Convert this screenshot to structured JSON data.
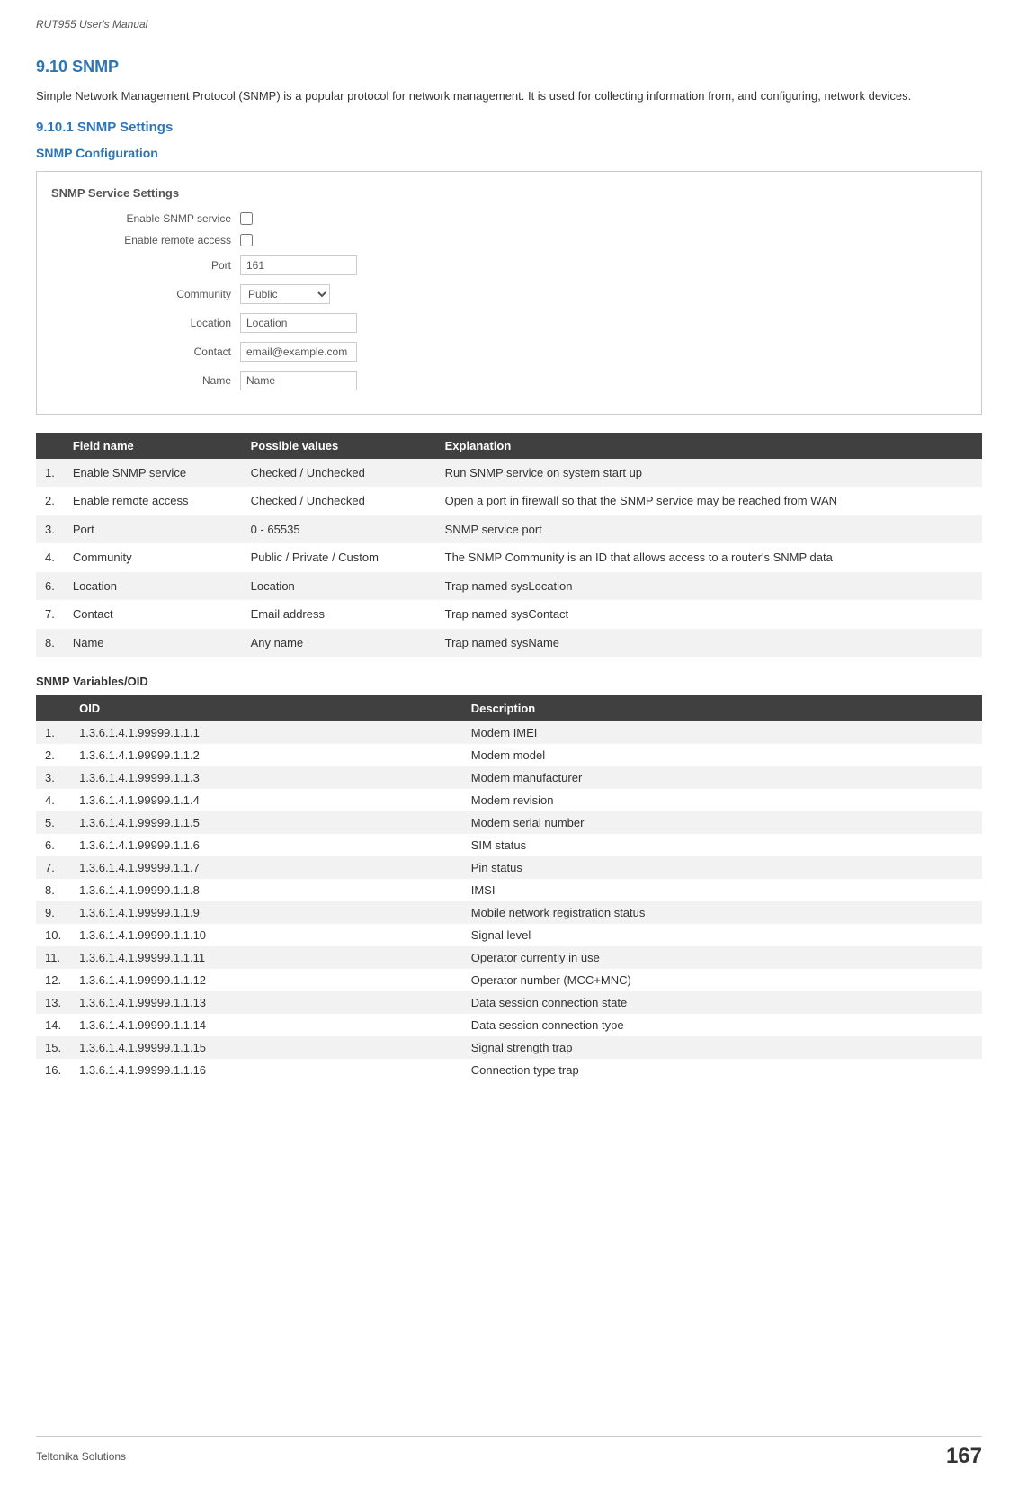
{
  "header": {
    "title": "RUT955 User's Manual"
  },
  "section": {
    "number": "9.10",
    "title": "SNMP",
    "description": "Simple Network Management Protocol (SNMP) is a popular protocol for network management. It is used for collecting information from, and configuring, network devices."
  },
  "subsection": {
    "number": "9.10.1",
    "title": "SNMP Settings"
  },
  "config": {
    "title": "SNMP Configuration",
    "section_label": "SNMP Service Settings",
    "fields": {
      "enable_snmp_label": "Enable SNMP service",
      "enable_remote_label": "Enable remote access",
      "port_label": "Port",
      "port_value": "161",
      "community_label": "Community",
      "community_value": "Public",
      "location_label": "Location",
      "location_value": "Location",
      "contact_label": "Contact",
      "contact_value": "email@example.com",
      "name_label": "Name",
      "name_value": "Name"
    }
  },
  "main_table": {
    "columns": [
      "",
      "Field name",
      "Possible values",
      "Explanation"
    ],
    "rows": [
      {
        "num": "1.",
        "field": "Enable SNMP service",
        "values": "Checked / Unchecked",
        "explanation": "Run SNMP service on system start up"
      },
      {
        "num": "2.",
        "field": "Enable remote access",
        "values": "Checked / Unchecked",
        "explanation": "Open a port in firewall so that the SNMP service may be reached from WAN"
      },
      {
        "num": "3.",
        "field": "Port",
        "values": "0 - 65535",
        "explanation": "SNMP service port"
      },
      {
        "num": "4.",
        "field": "Community",
        "values": "Public / Private / Custom",
        "explanation": "The SNMP Community is an ID that allows access to a router's SNMP data"
      },
      {
        "num": "6.",
        "field": "Location",
        "values": "Location",
        "explanation": "Trap named sysLocation"
      },
      {
        "num": "7.",
        "field": "Contact",
        "values": "Email address",
        "explanation": "Trap named sysContact"
      },
      {
        "num": "8.",
        "field": "Name",
        "values": "Any name",
        "explanation": "Trap named sysName"
      }
    ]
  },
  "variables_section": {
    "title": "SNMP Variables/OID",
    "columns": [
      "",
      "OID",
      "Description"
    ],
    "rows": [
      {
        "num": "1.",
        "oid": "1.3.6.1.4.1.99999.1.1.1",
        "description": "Modem IMEI"
      },
      {
        "num": "2.",
        "oid": "1.3.6.1.4.1.99999.1.1.2",
        "description": "Modem model"
      },
      {
        "num": "3.",
        "oid": "1.3.6.1.4.1.99999.1.1.3",
        "description": "Modem manufacturer"
      },
      {
        "num": "4.",
        "oid": "1.3.6.1.4.1.99999.1.1.4",
        "description": "Modem revision"
      },
      {
        "num": "5.",
        "oid": "1.3.6.1.4.1.99999.1.1.5",
        "description": "Modem serial number"
      },
      {
        "num": "6.",
        "oid": "1.3.6.1.4.1.99999.1.1.6",
        "description": "SIM status"
      },
      {
        "num": "7.",
        "oid": "1.3.6.1.4.1.99999.1.1.7",
        "description": "Pin status"
      },
      {
        "num": "8.",
        "oid": "1.3.6.1.4.1.99999.1.1.8",
        "description": "IMSI"
      },
      {
        "num": "9.",
        "oid": "1.3.6.1.4.1.99999.1.1.9",
        "description": "Mobile network registration status"
      },
      {
        "num": "10.",
        "oid": "1.3.6.1.4.1.99999.1.1.10",
        "description": "Signal level"
      },
      {
        "num": "11.",
        "oid": "1.3.6.1.4.1.99999.1.1.11",
        "description": "Operator currently in use"
      },
      {
        "num": "12.",
        "oid": "1.3.6.1.4.1.99999.1.1.12",
        "description": "Operator number (MCC+MNC)"
      },
      {
        "num": "13.",
        "oid": "1.3.6.1.4.1.99999.1.1.13",
        "description": "Data session connection state"
      },
      {
        "num": "14.",
        "oid": "1.3.6.1.4.1.99999.1.1.14",
        "description": "Data session connection type"
      },
      {
        "num": "15.",
        "oid": "1.3.6.1.4.1.99999.1.1.15",
        "description": "Signal strength trap"
      },
      {
        "num": "16.",
        "oid": "1.3.6.1.4.1.99999.1.1.16",
        "description": "Connection type trap"
      }
    ]
  },
  "footer": {
    "company": "Teltonika Solutions",
    "page": "167"
  }
}
